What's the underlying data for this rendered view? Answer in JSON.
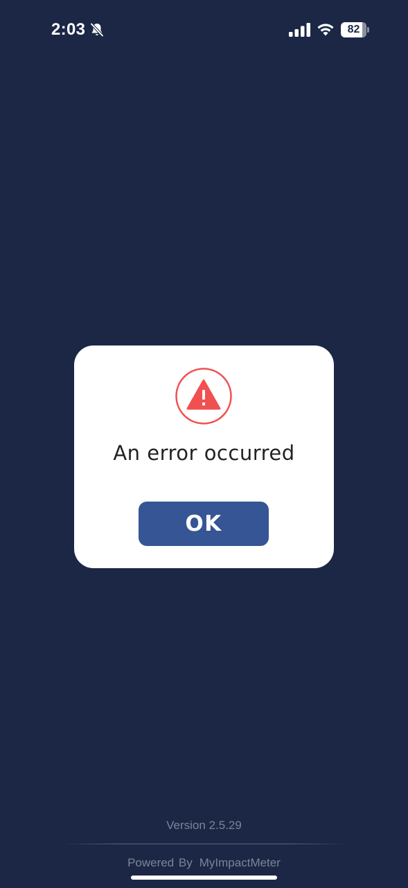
{
  "status_bar": {
    "time": "2:03",
    "battery_level": "82",
    "icons": [
      "bell-slash-icon",
      "cellular-signal-icon",
      "wifi-icon",
      "battery-icon"
    ]
  },
  "dialog": {
    "icon": "warning-triangle-icon",
    "message": "An error occurred",
    "ok_label": "OK",
    "colors": {
      "icon_red": "#f05050",
      "button": "#355595"
    }
  },
  "footer": {
    "version": "Version 2.5.29",
    "powered_by_label": "Powered By",
    "brand": "MyImpactMeter"
  },
  "colors": {
    "background": "#1b2745"
  }
}
